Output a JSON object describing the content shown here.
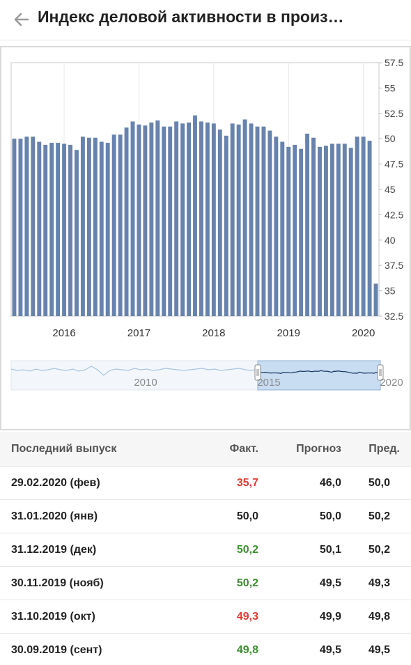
{
  "header": {
    "title": "Индекс деловой активности в произ…",
    "back_icon": "arrow-left-icon"
  },
  "colors": {
    "bar": "#6783ad",
    "navigator_fill": "#c8dcf2",
    "navigator_line": "#1f3e66",
    "up": "#3b8f2e",
    "down": "#e03a2f"
  },
  "chart_data": {
    "type": "bar",
    "y_ticks": [
      "57.5",
      "55",
      "52.5",
      "50",
      "47.5",
      "45",
      "42.5",
      "40",
      "37.5",
      "35",
      "32.5"
    ],
    "ylim": [
      32.5,
      57.5
    ],
    "x_labels": [
      {
        "label": "2016",
        "index": 8
      },
      {
        "label": "2017",
        "index": 20
      },
      {
        "label": "2018",
        "index": 32
      },
      {
        "label": "2019",
        "index": 44
      },
      {
        "label": "2020",
        "index": 56
      }
    ],
    "values": [
      50.0,
      50.0,
      50.2,
      50.2,
      49.7,
      49.4,
      49.6,
      49.6,
      49.5,
      49.4,
      48.9,
      50.2,
      50.1,
      50.1,
      49.7,
      49.6,
      50.4,
      50.4,
      51.1,
      51.7,
      51.4,
      51.3,
      51.6,
      51.8,
      51.2,
      51.2,
      51.7,
      51.5,
      51.6,
      52.3,
      51.7,
      51.6,
      51.5,
      50.9,
      50.3,
      51.5,
      51.4,
      51.9,
      51.5,
      51.2,
      51.2,
      50.8,
      50.2,
      49.7,
      49.2,
      49.4,
      49.0,
      50.5,
      50.1,
      49.2,
      49.3,
      49.5,
      49.5,
      49.5,
      49.1,
      50.2,
      50.2,
      49.8,
      35.7
    ]
  },
  "navigator": {
    "labels": [
      "2010",
      "2015",
      "2020"
    ]
  },
  "table": {
    "headers": {
      "date": "Последний выпуск",
      "actual": "Факт.",
      "forecast": "Прогноз",
      "previous": "Пред."
    },
    "rows": [
      {
        "date": "29.02.2020 (фев)",
        "actual": "35,7",
        "actual_color": "red",
        "forecast": "46,0",
        "previous": "50,0"
      },
      {
        "date": "31.01.2020 (янв)",
        "actual": "50,0",
        "actual_color": "black",
        "forecast": "50,0",
        "previous": "50,2"
      },
      {
        "date": "31.12.2019 (дек)",
        "actual": "50,2",
        "actual_color": "green",
        "forecast": "50,1",
        "previous": "50,2"
      },
      {
        "date": "30.11.2019 (нояб)",
        "actual": "50,2",
        "actual_color": "green",
        "forecast": "49,5",
        "previous": "49,3"
      },
      {
        "date": "31.10.2019 (окт)",
        "actual": "49,3",
        "actual_color": "red",
        "forecast": "49,9",
        "previous": "49,8"
      },
      {
        "date": "30.09.2019 (сент)",
        "actual": "49,8",
        "actual_color": "green",
        "forecast": "49,5",
        "previous": "49,5"
      }
    ]
  }
}
